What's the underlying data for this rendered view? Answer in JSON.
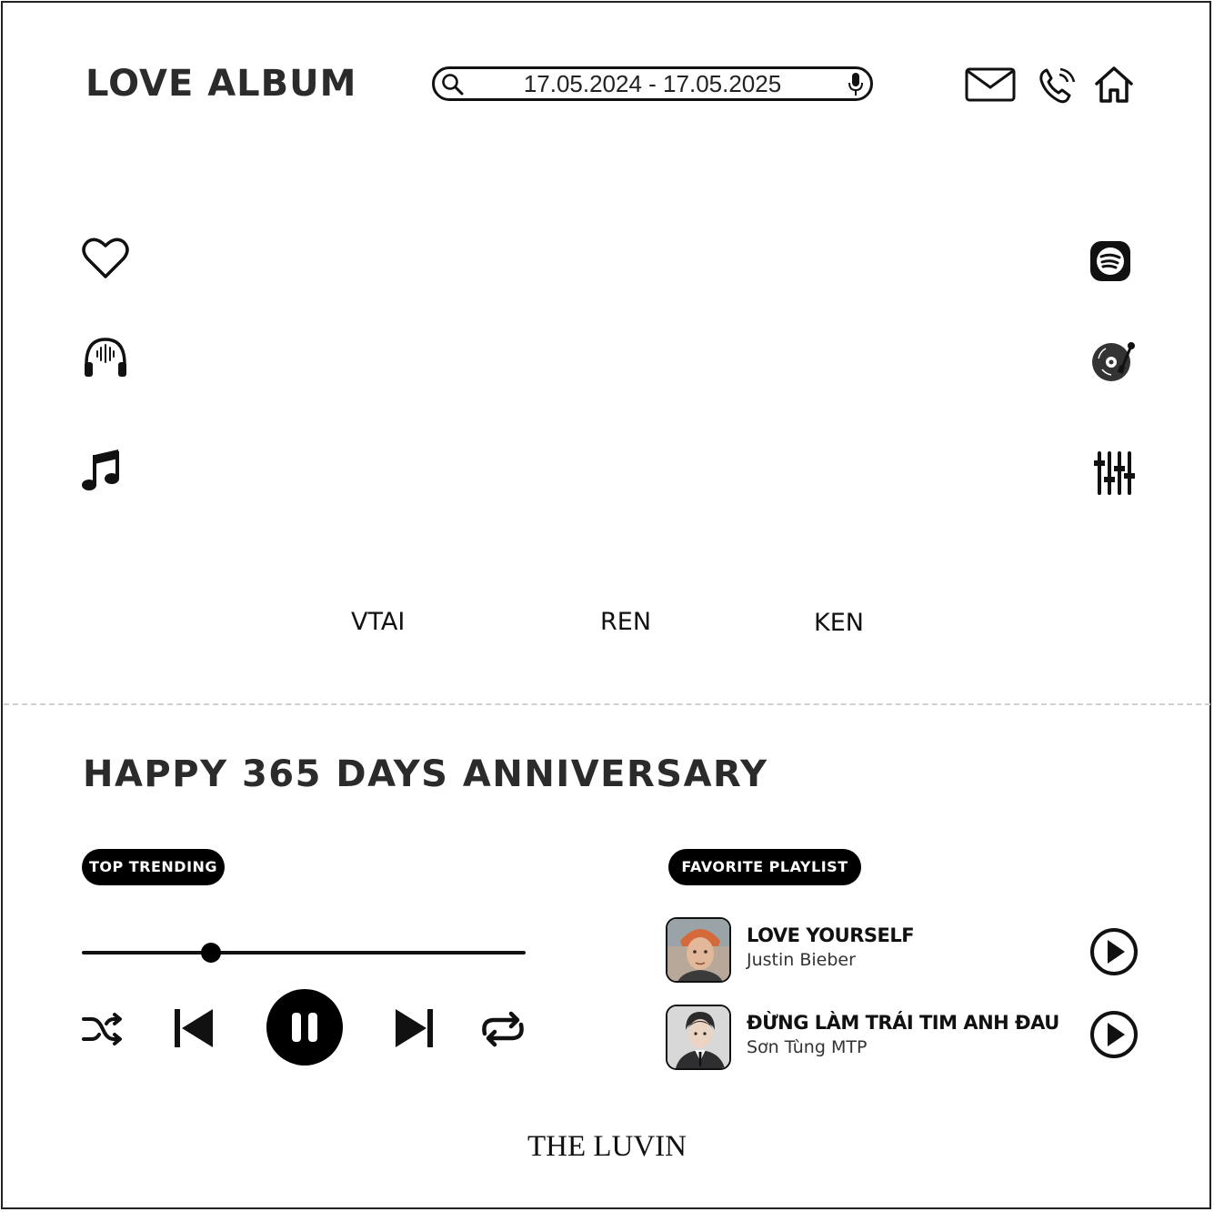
{
  "header": {
    "title": "LOVE ALBUM",
    "search_value": "17.05.2024 - 17.05.2025",
    "icons": [
      "mail-icon",
      "phone-icon",
      "home-icon"
    ]
  },
  "left_icons": [
    "heart-icon",
    "headphones-icon",
    "music-note-icon"
  ],
  "right_icons": [
    "spotify-icon",
    "turntable-icon",
    "equalizer-icon"
  ],
  "people": [
    "VTAI",
    "REN",
    "KEN"
  ],
  "headline": "HAPPY 365 DAYS ANNIVERSARY",
  "player": {
    "label": "TOP TRENDING",
    "progress": 0.29,
    "controls": [
      "shuffle-icon",
      "previous-icon",
      "pause-icon",
      "next-icon",
      "repeat-icon"
    ]
  },
  "playlist": {
    "label": "FAVORITE PLAYLIST",
    "songs": [
      {
        "title": "LOVE YOURSELF",
        "artist": "Justin Bieber"
      },
      {
        "title": "ĐỪNG LÀM TRÁI TIM ANH ĐAU",
        "artist": "Sơn Tùng MTP"
      }
    ]
  },
  "footer": "THE LUVIN",
  "colors": {
    "ink": "#111111",
    "accent": "#000000",
    "divider": "#d0d0d0"
  }
}
